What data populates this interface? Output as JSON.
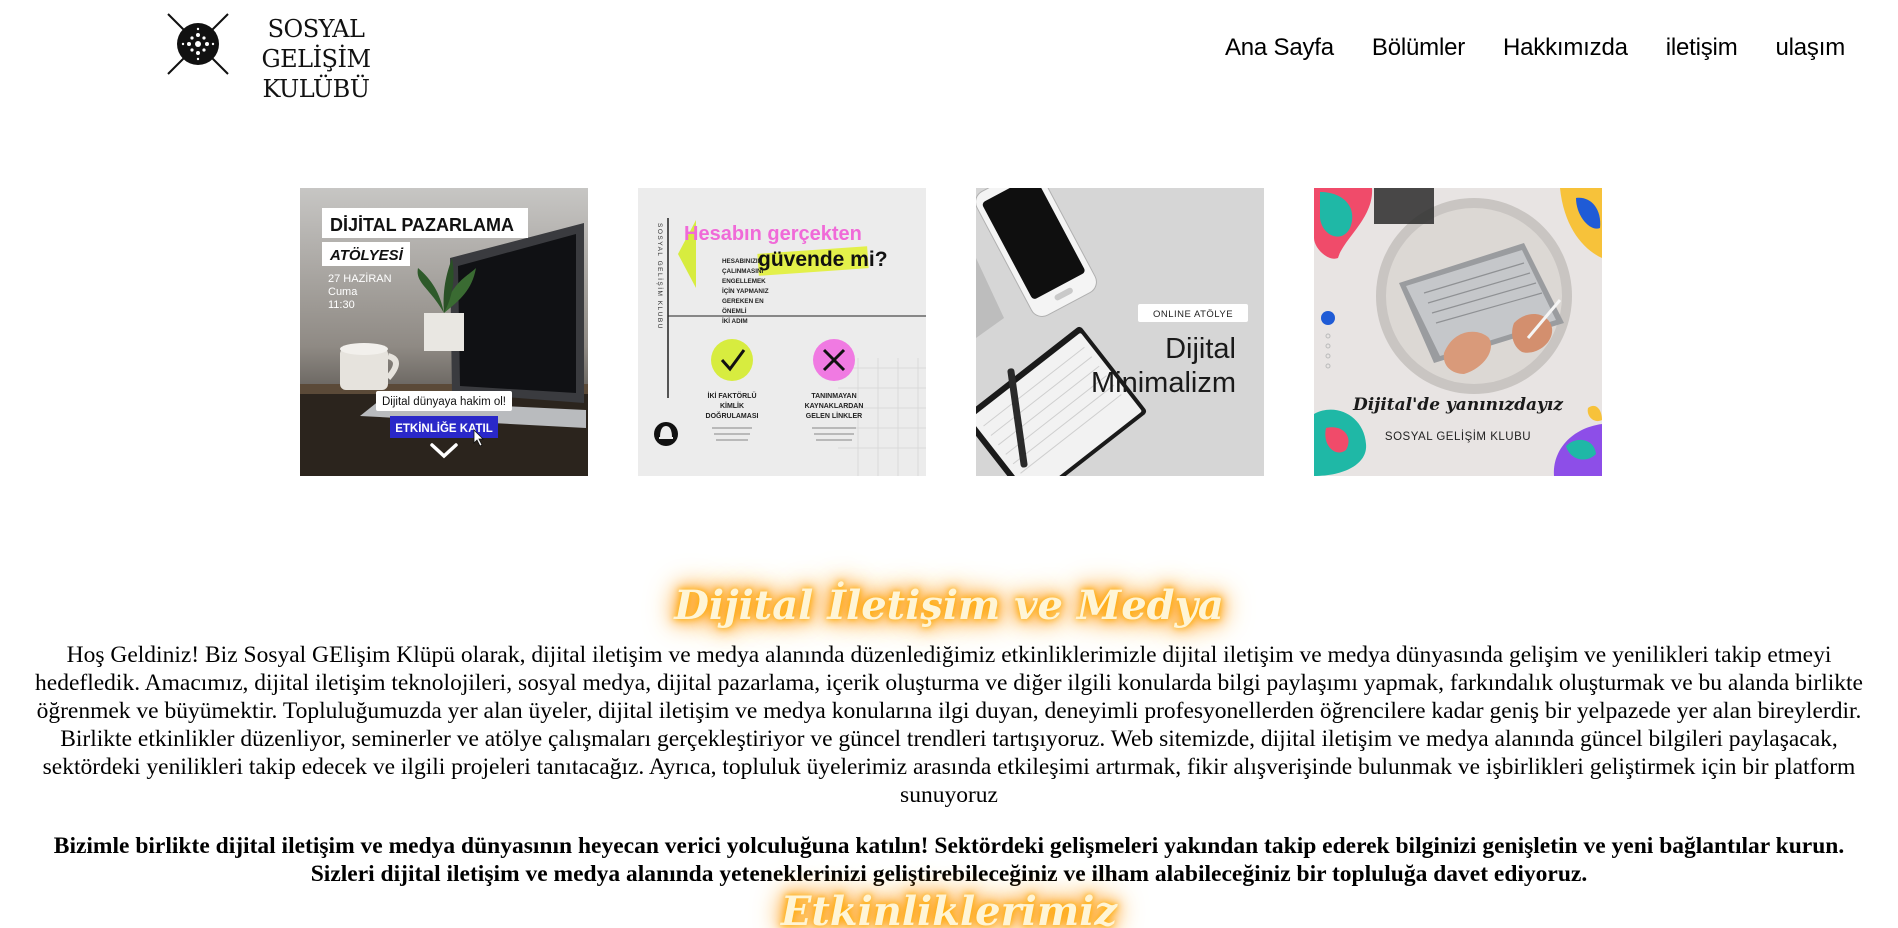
{
  "header": {
    "logo_line1": "SOSYAL GELİŞİM",
    "logo_line2": "KULÜBÜ",
    "nav": [
      {
        "label": "Ana Sayfa"
      },
      {
        "label": "Bölümler"
      },
      {
        "label": "Hakkımızda"
      },
      {
        "label": "iletişim"
      },
      {
        "label": "ulaşım"
      }
    ]
  },
  "gallery": {
    "card1": {
      "title": "DİJİTAL PAZARLAMA",
      "subtitle": "ATÖLYESİ",
      "date": "27 HAZİRAN",
      "day": "Cuma",
      "time": "11:30",
      "tagline": "Dijital dünyaya hakim ol!",
      "cta": "ETKİNLİĞE KATIL"
    },
    "card2": {
      "vertical_text": "SOSYAL GELİŞİM KLUBU",
      "headline1": "Hesabın gerçekten",
      "headline2": "güvende mi?",
      "lead": [
        "HESABINIZIN",
        "ÇALINMASINI",
        "ENGELLEMEK",
        "İÇİN YAPMANIZ",
        "GEREKEN EN",
        "ÖNEMLİ",
        "İKİ ADIM"
      ],
      "item1": [
        "İKİ FAKTÖRLÜ",
        "KİMLİK",
        "DOĞRULAMASI"
      ],
      "item2": [
        "TANINMAYAN",
        "KAYNAKLARDAN",
        "GELEN LİNKLER"
      ]
    },
    "card3": {
      "badge": "ONLINE ATÖLYE",
      "title1": "Dijital",
      "title2": "Minimalizm"
    },
    "card4": {
      "tagline": "Dijital'de yanınızdayız",
      "club": "SOSYAL GELİŞİM KLUBU"
    }
  },
  "content": {
    "title": "Dijital İletişim ve Medya",
    "intro": "Hoş Geldiniz! Biz Sosyal GElişim Klüpü olarak, dijital iletişim ve medya alanında düzenlediğimiz etkinliklerimizle dijital iletişim ve medya dünyasında gelişim ve yenilikleri takip etmeyi hedefledik. Amacımız, dijital iletişim teknolojileri, sosyal medya, dijital pazarlama, içerik oluşturma ve diğer ilgili konularda bilgi paylaşımı yapmak, farkındalık oluşturmak ve bu alanda birlikte öğrenmek ve büyümektir. Topluluğumuzda yer alan üyeler, dijital iletişim ve medya konularına ilgi duyan, deneyimli profesyonellerden öğrencilere kadar geniş bir yelpazede yer alan bireylerdir. Birlikte etkinlikler düzenliyor, seminerler ve atölye çalışmaları gerçekleştiriyor ve güncel trendleri tartışıyoruz. Web sitemizde, dijital iletişim ve medya alanında güncel bilgileri paylaşacak, sektördeki yenilikleri takip edecek ve ilgili projeleri tanıtacağız. Ayrıca, topluluk üyelerimiz arasında etkileşimi artırmak, fikir alışverişinde bulunmak ve işbirlikleri geliştirmek için bir platform sunuyoruz",
    "invite": "Bizimle birlikte dijital iletişim ve medya dünyasının heyecan verici yolculuğuna katılın! Sektördeki gelişmeleri yakından takip ederek bilginizi genişletin ve yeni bağlantılar kurun. Sizleri dijital iletişim ve medya alanında yeteneklerinizi geliştirebileceğiniz ve ilham alabileceğiniz bir topluluğa davet ediyoruz.",
    "events_title": "Etkinliklerimiz"
  }
}
